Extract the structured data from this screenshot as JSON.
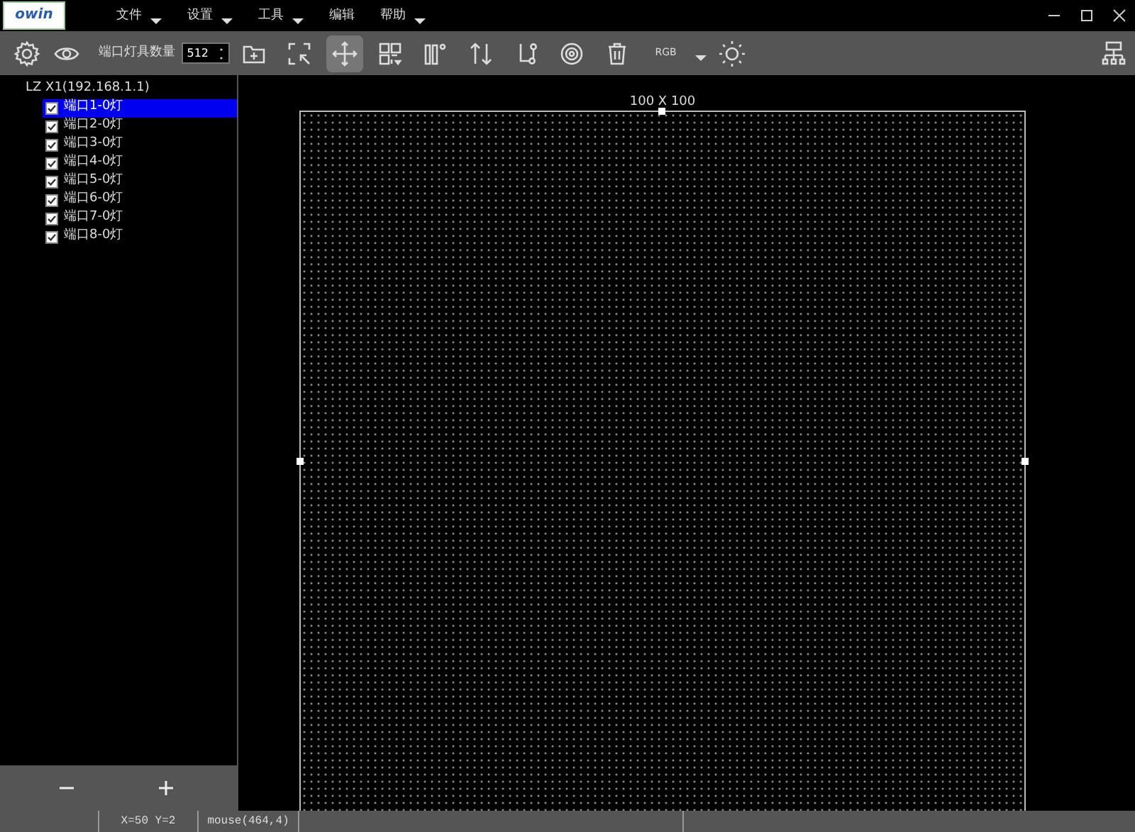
{
  "app": {
    "logo": "owin"
  },
  "menu": [
    {
      "label": "文件",
      "dropdown": true
    },
    {
      "label": "设置",
      "dropdown": true
    },
    {
      "label": "工具",
      "dropdown": true
    },
    {
      "label": "编辑",
      "dropdown": false
    },
    {
      "label": "帮助",
      "dropdown": true
    }
  ],
  "toolbar": {
    "port_light_label": "端口灯具数量",
    "port_light_count": "512",
    "color_order": "RGB",
    "tools": [
      {
        "kind": "add-folder",
        "selected": false
      },
      {
        "kind": "fit",
        "selected": false
      },
      {
        "kind": "move",
        "selected": true
      },
      {
        "kind": "grid",
        "selected": false
      },
      {
        "kind": "columns",
        "selected": false
      },
      {
        "kind": "swap",
        "selected": false
      },
      {
        "kind": "branch",
        "selected": false
      },
      {
        "kind": "target",
        "selected": false
      },
      {
        "kind": "trash",
        "selected": false
      }
    ]
  },
  "tree": {
    "root": "LZ X1(192.168.1.1)",
    "children": [
      {
        "label": "端口1-0灯",
        "checked": true,
        "selected": true
      },
      {
        "label": "端口2-0灯",
        "checked": true,
        "selected": false
      },
      {
        "label": "端口3-0灯",
        "checked": true,
        "selected": false
      },
      {
        "label": "端口4-0灯",
        "checked": true,
        "selected": false
      },
      {
        "label": "端口5-0灯",
        "checked": true,
        "selected": false
      },
      {
        "label": "端口6-0灯",
        "checked": true,
        "selected": false
      },
      {
        "label": "端口7-0灯",
        "checked": true,
        "selected": false
      },
      {
        "label": "端口8-0灯",
        "checked": true,
        "selected": false
      }
    ]
  },
  "canvas": {
    "size_label": "100 X 100"
  },
  "status_bar": {
    "position": "X=50 Y=2",
    "mouse": "mouse(464,4)"
  }
}
